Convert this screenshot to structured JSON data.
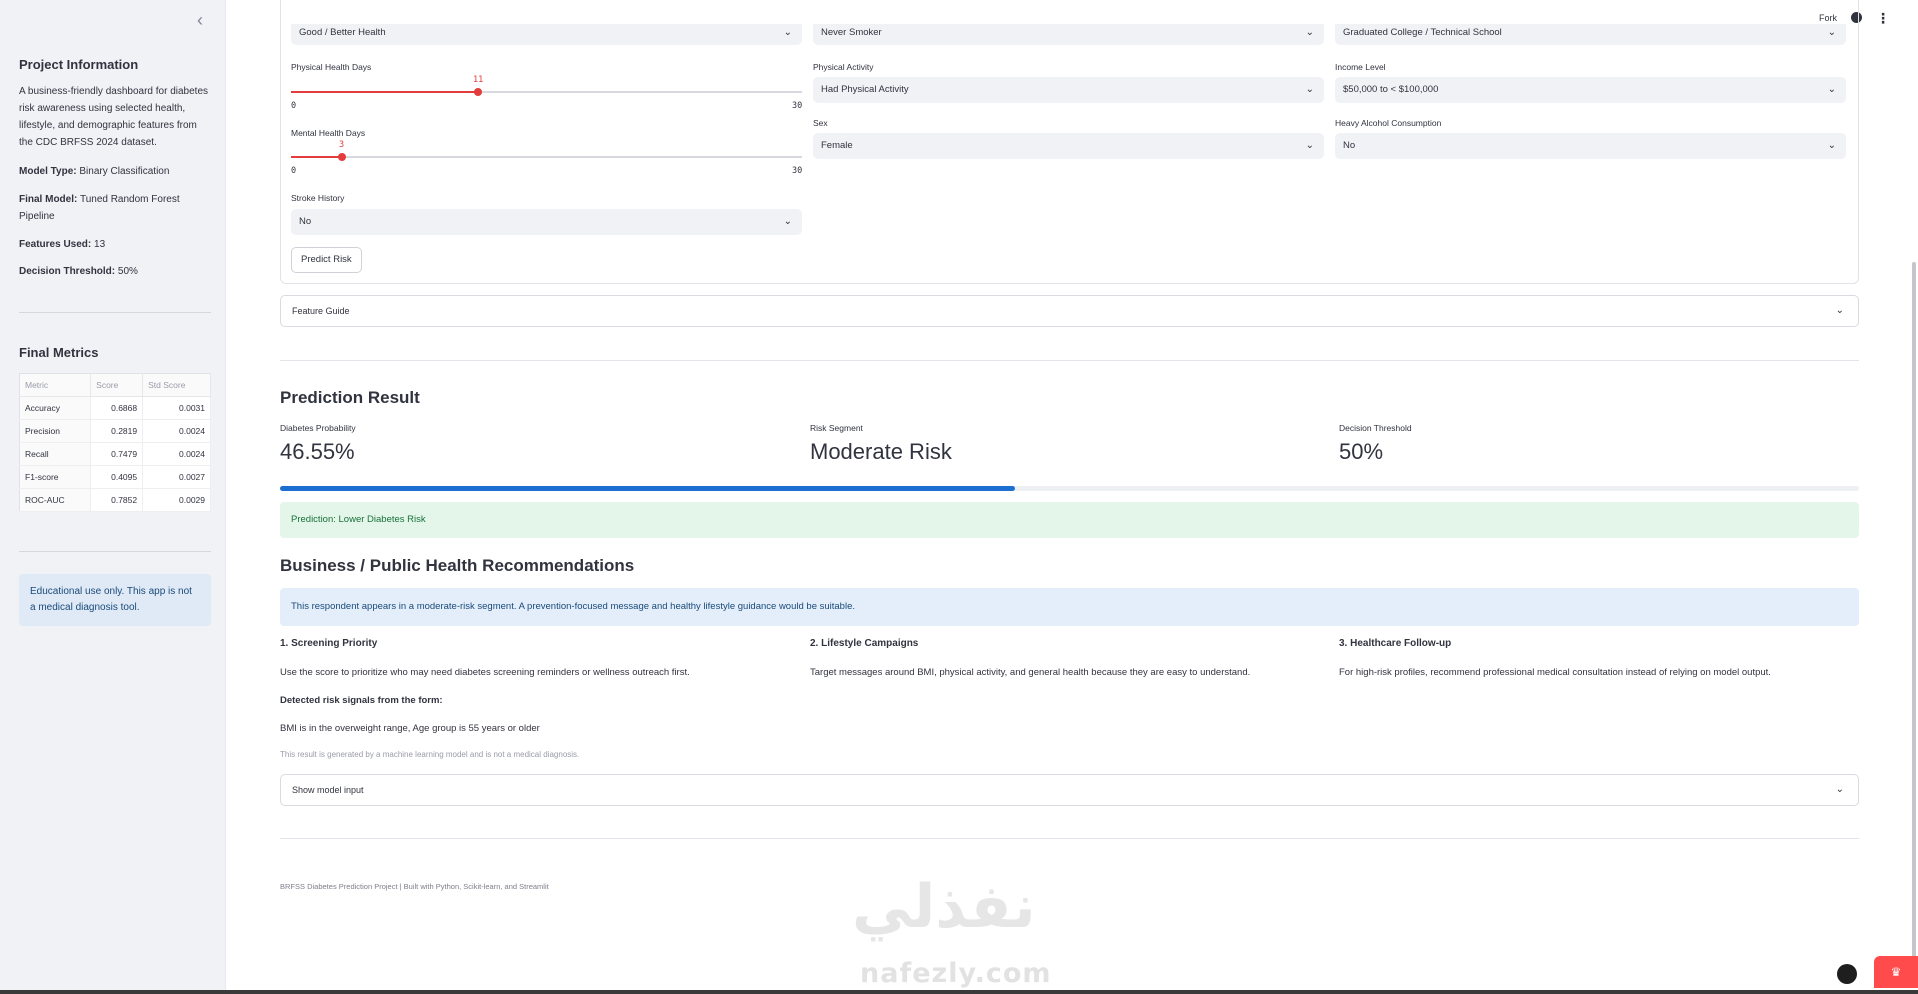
{
  "sidebar": {
    "collapse_icon": "chevron-left-icon",
    "project_title": "Project Information",
    "description": "A business-friendly dashboard for diabetes risk awareness using selected health, lifestyle, and demographic features from the CDC BRFSS 2024 dataset.",
    "model_type_label": "Model Type:",
    "model_type_value": "Binary Classification",
    "final_model_label": "Final Model:",
    "final_model_value": "Tuned Random Forest Pipeline",
    "features_label": "Features Used:",
    "features_value": "13",
    "threshold_label": "Decision Threshold:",
    "threshold_value": "50%",
    "metrics_title": "Final Metrics",
    "metrics_headers": [
      "Metric",
      "Score",
      "Std Score"
    ],
    "metrics_rows": [
      [
        "Accuracy",
        "0.6868",
        "0.0031"
      ],
      [
        "Precision",
        "0.2819",
        "0.0024"
      ],
      [
        "Recall",
        "0.7479",
        "0.0024"
      ],
      [
        "F1-score",
        "0.4095",
        "0.0027"
      ],
      [
        "ROC-AUC",
        "0.7852",
        "0.0029"
      ]
    ],
    "disclaimer": "Educational use only. This app is not a medical diagnosis tool."
  },
  "topbar": {
    "fork_label": "Fork",
    "github_icon": "github-icon",
    "menu_icon": "more-vertical-icon"
  },
  "form": {
    "general_health_value": "Good / Better Health",
    "smoking_value": "Never Smoker",
    "education_value": "Graduated College / Technical School",
    "physical_health_label": "Physical Health Days",
    "physical_health_value": "11",
    "physical_health_min": "0",
    "physical_health_max": "30",
    "physical_health_level": 11,
    "mental_health_label": "Mental Health Days",
    "mental_health_value": "3",
    "mental_health_min": "0",
    "mental_health_max": "30",
    "mental_health_level": 3,
    "stroke_label": "Stroke History",
    "stroke_value": "No",
    "physical_activity_label": "Physical Activity",
    "physical_activity_value": "Had Physical Activity",
    "sex_label": "Sex",
    "sex_value": "Female",
    "income_label": "Income Level",
    "income_value": "$50,000 to < $100,000",
    "alcohol_label": "Heavy Alcohol Consumption",
    "alcohol_value": "No",
    "predict_button": "Predict Risk"
  },
  "feature_guide": "Feature Guide",
  "result": {
    "title": "Prediction Result",
    "probability_label": "Diabetes Probability",
    "probability_value": "46.55%",
    "probability_fraction": 0.4655,
    "segment_label": "Risk Segment",
    "segment_value": "Moderate Risk",
    "threshold_label": "Decision Threshold",
    "threshold_value": "50%",
    "prediction_text": "Prediction: Lower Diabetes Risk"
  },
  "recommendations": {
    "title": "Business / Public Health Recommendations",
    "info": "This respondent appears in a moderate-risk segment. A prevention-focused message and healthy lifestyle guidance would be suitable.",
    "items": [
      {
        "title": "1. Screening Priority",
        "text": "Use the score to prioritize who may need diabetes screening reminders or wellness outreach first."
      },
      {
        "title": "2. Lifestyle Campaigns",
        "text": "Target messages around BMI, physical activity, and general health because they are easy to understand."
      },
      {
        "title": "3. Healthcare Follow-up",
        "text": "For high-risk profiles, recommend professional medical consultation instead of relying on model output."
      }
    ],
    "signals_title": "Detected risk signals from the form:",
    "signals_text": "BMI is in the overweight range, Age group is 55 years or older",
    "caption": "This result is generated by a machine learning model and is not a medical diagnosis."
  },
  "model_input_expander": "Show model input",
  "footer": "BRFSS Diabetes Prediction Project | Built with Python, Scikit-learn, and Streamlit",
  "watermark": {
    "arabic": "نفذلي",
    "latin": "nafezly.com"
  },
  "colors": {
    "accent": "#ff4b4b",
    "progress": "#1c6fd1",
    "success_bg": "#e4f6ea",
    "info_bg": "#e3eefa"
  }
}
